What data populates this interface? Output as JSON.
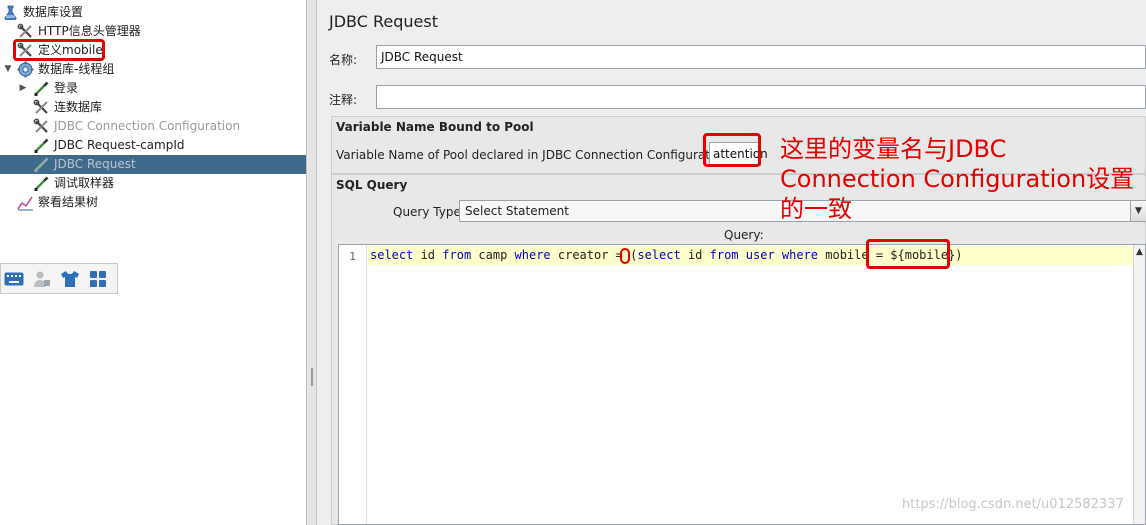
{
  "tree": {
    "items": [
      {
        "label": "数据库设置",
        "icon": "flask-icon"
      },
      {
        "label": "HTTP信息头管理器",
        "icon": "wrench-icon"
      },
      {
        "label": "定义mobile",
        "icon": "wrench-icon"
      },
      {
        "label": "数据库-线程组",
        "icon": "gear-icon"
      },
      {
        "label": "登录",
        "icon": "pipette-icon"
      },
      {
        "label": "连数据库",
        "icon": "wrench-icon"
      },
      {
        "label": "JDBC Connection Configuration",
        "icon": "wrench-icon"
      },
      {
        "label": "JDBC Request-campId",
        "icon": "pipette-icon"
      },
      {
        "label": "JDBC Request",
        "icon": "pipette-icon"
      },
      {
        "label": "调试取样器",
        "icon": "pipette-icon"
      },
      {
        "label": "察看结果树",
        "icon": "chart-icon"
      }
    ]
  },
  "panel": {
    "title": "JDBC Request",
    "name_label": "名称:",
    "name_value": "JDBC Request",
    "comment_label": "注释:",
    "comment_value": "",
    "pool_section_title": "Variable Name Bound to Pool",
    "pool_label": "Variable Name of Pool declared in JDBC Connection Configuration:",
    "pool_value": "attention",
    "sql_section_title": "SQL Query",
    "query_type_label": "Query Type:",
    "query_type_value": "Select Statement",
    "query_label": "Query:",
    "line_number": "1"
  },
  "annotation": {
    "note": "这里的变量名与JDBC Connection Configuration设置的一致"
  },
  "watermark": "https://blog.csdn.net/u012582337",
  "colors": {
    "selection": "#3f6a8c",
    "annotation_red": "#e60000",
    "keyword_blue": "#0000cc",
    "current_line": "#ffffcc"
  }
}
